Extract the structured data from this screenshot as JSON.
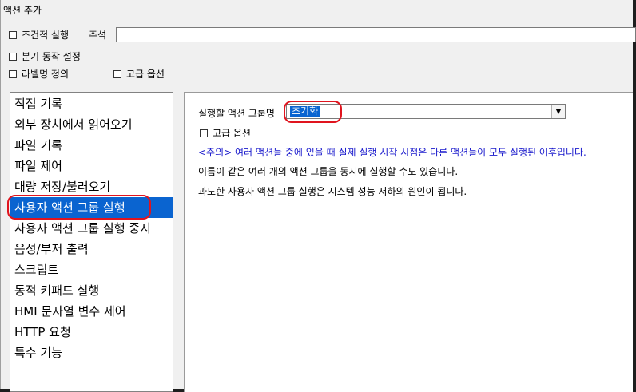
{
  "window": {
    "title": "액션 추가"
  },
  "options": {
    "conditional_exec": "조건적 실행",
    "note_label": "주석",
    "note_value": "",
    "branch_setting": "분기 동작 설정",
    "label_def": "라벨명 정의",
    "advanced": "고급 옵션"
  },
  "actions": [
    "직접 기록",
    "외부 장치에서 읽어오기",
    "파일 기록",
    "파일 제어",
    "대량 저장/불러오기",
    "사용자 액션 그룹 실행",
    "사용자 액션 그룹 실행 중지",
    "음성/부저 출력",
    "스크립트",
    "동적 키패드 실행",
    "HMI 문자열 변수 제어",
    "HTTP 요청",
    "특수 기능"
  ],
  "selected_index": 5,
  "panel": {
    "group_label": "실행할 액션 그룹명",
    "group_value": "초기화",
    "advanced_label": "고급 옵션",
    "warning": "<주의> 여러 액션들 중에 있을 때 실제 실행 시작 시점은 다른 액션들이 모두 실행된 이후입니다.",
    "info1": "이름이 같은 여러 개의 액션 그룹을 동시에 실행할 수도 있습니다.",
    "info2": "과도한 사용자 액션 그룹 실행은 시스템 성능 저하의 원인이 됩니다."
  },
  "colors": {
    "selection": "#0a64d0",
    "highlight_ring": "#e0141e",
    "warning_text": "#1a1acc"
  }
}
